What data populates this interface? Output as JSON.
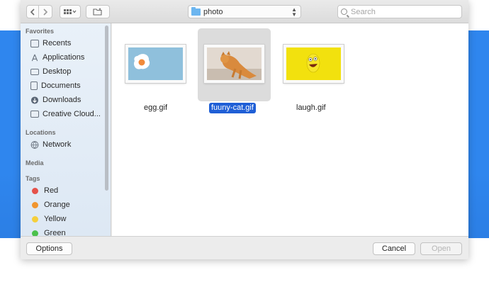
{
  "toolbar": {
    "back_icon": "chevron-left-icon",
    "forward_icon": "chevron-right-icon",
    "view_icon": "grid-view-icon",
    "new_folder_icon": "new-folder-icon",
    "path": "photo",
    "search_placeholder": "Search"
  },
  "sidebar": {
    "favorites_header": "Favorites",
    "favorites": [
      {
        "label": "Recents",
        "icon": "recents-icon"
      },
      {
        "label": "Applications",
        "icon": "applications-icon"
      },
      {
        "label": "Desktop",
        "icon": "desktop-icon"
      },
      {
        "label": "Documents",
        "icon": "documents-icon"
      },
      {
        "label": "Downloads",
        "icon": "downloads-icon"
      },
      {
        "label": "Creative Cloud...",
        "icon": "folder-icon"
      }
    ],
    "locations_header": "Locations",
    "locations": [
      {
        "label": "Network",
        "icon": "network-icon"
      }
    ],
    "media_header": "Media",
    "tags_header": "Tags",
    "tags": [
      {
        "label": "Red",
        "color": "#e5524a"
      },
      {
        "label": "Orange",
        "color": "#f0952f"
      },
      {
        "label": "Yellow",
        "color": "#f5cf3b"
      },
      {
        "label": "Green",
        "color": "#4cc14c"
      }
    ]
  },
  "files": [
    {
      "name": "egg.gif",
      "selected": false
    },
    {
      "name": "fuuny-cat.gif",
      "selected": true
    },
    {
      "name": "laugh.gif",
      "selected": false
    }
  ],
  "bottom": {
    "options_label": "Options",
    "cancel_label": "Cancel",
    "open_label": "Open"
  }
}
